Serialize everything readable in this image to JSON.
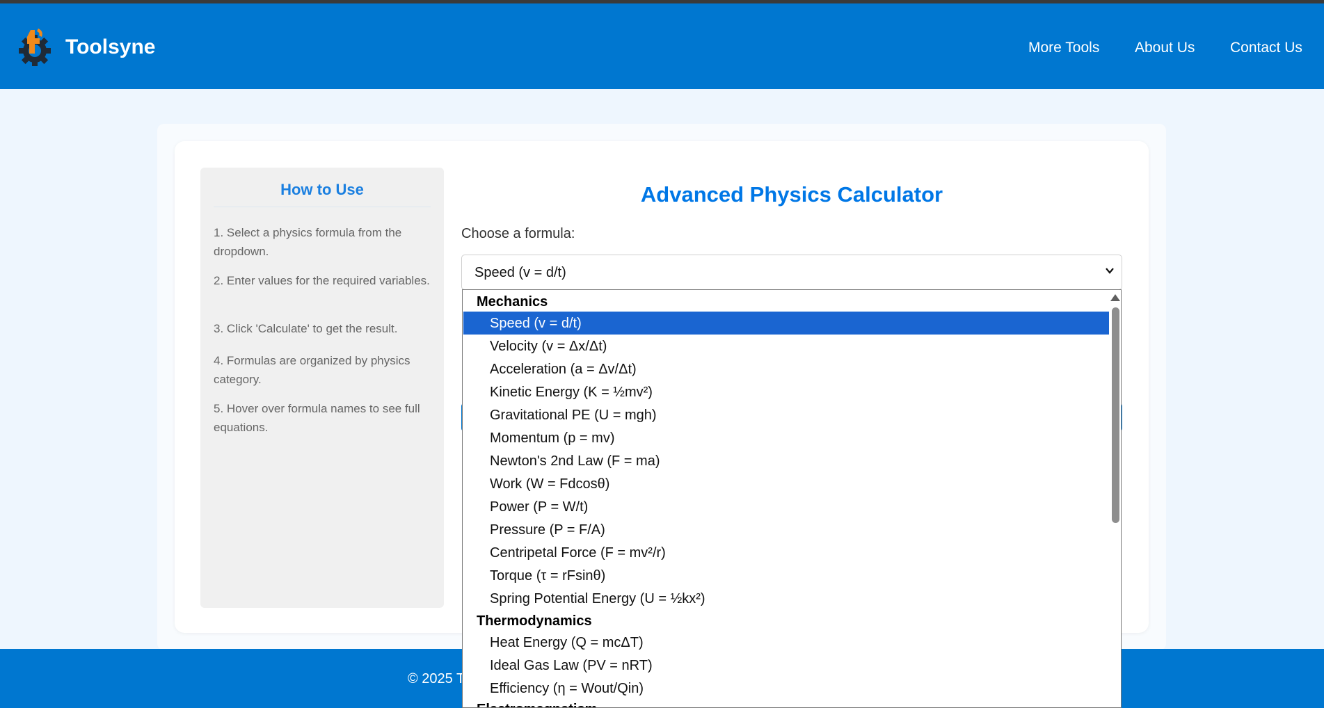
{
  "header": {
    "brand": "Toolsyne",
    "nav": [
      "More Tools",
      "About Us",
      "Contact Us"
    ]
  },
  "howto": {
    "title": "How to Use",
    "steps": [
      "1. Select a physics formula from the dropdown.",
      "2. Enter values for the required variables.",
      "3. Click 'Calculate' to get the result.",
      "4. Formulas are organized by physics category.",
      "5. Hover over formula names to see full equations."
    ]
  },
  "main": {
    "title": "Advanced Physics Calculator",
    "choose_label": "Choose a formula:",
    "selected_value": "Speed (v = d/t)"
  },
  "dropdown": {
    "groups": [
      {
        "label": "Mechanics",
        "options": [
          "Speed (v = d/t)",
          "Velocity (v = Δx/Δt)",
          "Acceleration (a = Δv/Δt)",
          "Kinetic Energy (K = ½mv²)",
          "Gravitational PE (U = mgh)",
          "Momentum (p = mv)",
          "Newton's 2nd Law (F = ma)",
          "Work (W = Fdcosθ)",
          "Power (P = W/t)",
          "Pressure (P = F/A)",
          "Centripetal Force (F = mv²/r)",
          "Torque (τ = rFsinθ)",
          "Spring Potential Energy (U = ½kx²)"
        ]
      },
      {
        "label": "Thermodynamics",
        "options": [
          "Heat Energy (Q = mcΔT)",
          "Ideal Gas Law (PV = nRT)",
          "Efficiency (η = Wout/Qin)"
        ]
      },
      {
        "label": "Electromagnetism",
        "options": []
      }
    ]
  },
  "footer": {
    "copyright": "© 2025 T"
  },
  "colors": {
    "header_bg": "#0077d0",
    "title_blue": "#0077e6",
    "selected_option_bg": "#1a65d1"
  }
}
